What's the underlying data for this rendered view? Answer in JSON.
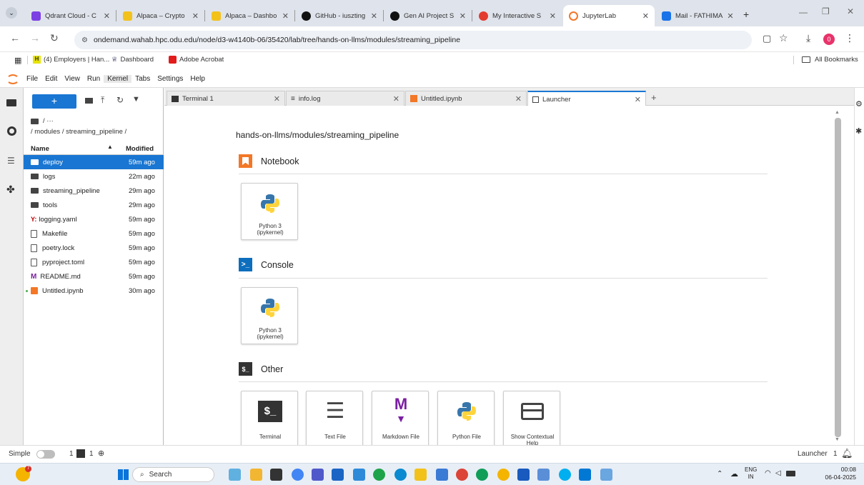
{
  "browser": {
    "tabs": [
      {
        "label": "Qdrant Cloud - C",
        "color": "#7b3fe4"
      },
      {
        "label": "Alpaca – Crypto",
        "color": "#f2c21b"
      },
      {
        "label": "Alpaca – Dashbo",
        "color": "#f2c21b"
      },
      {
        "label": "GitHub - iuszting",
        "color": "#111111"
      },
      {
        "label": "Gen AI Project S",
        "color": "#111111"
      },
      {
        "label": "My Interactive S",
        "color": "#e33b2e"
      },
      {
        "label": "JupyterLab",
        "color": "#f37726"
      },
      {
        "label": "Mail - FATHIMA",
        "color": "#1a73e8"
      }
    ],
    "url": "ondemand.wahab.hpc.odu.edu/node/d3-w4140b-06/35420/lab/tree/hands-on-llms/modules/streaming_pipeline",
    "profile_badge": "0",
    "bookmarks": [
      "(4) Employers | Han...",
      "Dashboard",
      "Adobe Acrobat"
    ],
    "all_bookmarks": "All Bookmarks"
  },
  "jupyter": {
    "menu": [
      "File",
      "Edit",
      "View",
      "Run",
      "Kernel",
      "Tabs",
      "Settings",
      "Help"
    ],
    "breadcrumb_top": "/ ···",
    "breadcrumb": "/ modules / streaming_pipeline /",
    "columns": {
      "name": "Name",
      "modified": "Modified"
    },
    "files": [
      {
        "name": "deploy",
        "modified": "59m ago",
        "kind": "folder"
      },
      {
        "name": "logs",
        "modified": "22m ago",
        "kind": "folder"
      },
      {
        "name": "streaming_pipeline",
        "modified": "29m ago",
        "kind": "folder"
      },
      {
        "name": "tools",
        "modified": "29m ago",
        "kind": "folder"
      },
      {
        "name": "logging.yaml",
        "modified": "59m ago",
        "kind": "yaml"
      },
      {
        "name": "Makefile",
        "modified": "59m ago",
        "kind": "file"
      },
      {
        "name": "poetry.lock",
        "modified": "59m ago",
        "kind": "file"
      },
      {
        "name": "pyproject.toml",
        "modified": "59m ago",
        "kind": "file"
      },
      {
        "name": "README.md",
        "modified": "59m ago",
        "kind": "md"
      },
      {
        "name": "Untitled.ipynb",
        "modified": "30m ago",
        "kind": "nb"
      }
    ],
    "doc_tabs": [
      "Terminal 1",
      "info.log",
      "Untitled.ipynb",
      "Launcher"
    ],
    "launcher": {
      "path": "hands-on-llms/modules/streaming_pipeline",
      "sections": {
        "notebook": "Notebook",
        "console": "Console",
        "other": "Other"
      },
      "kernel_label_1": "Python 3",
      "kernel_label_2": "(ipykernel)",
      "other_items": [
        "Terminal",
        "Text File",
        "Markdown File",
        "Python File",
        "Show Contextual Help"
      ]
    },
    "status": {
      "mode": "Simple",
      "count1": "1",
      "count2": "1",
      "right": "Launcher",
      "right_count": "1"
    }
  },
  "taskbar": {
    "search": "Search",
    "lang": "ENG",
    "region": "IN",
    "time": "00:08",
    "date": "06-04-2025"
  }
}
